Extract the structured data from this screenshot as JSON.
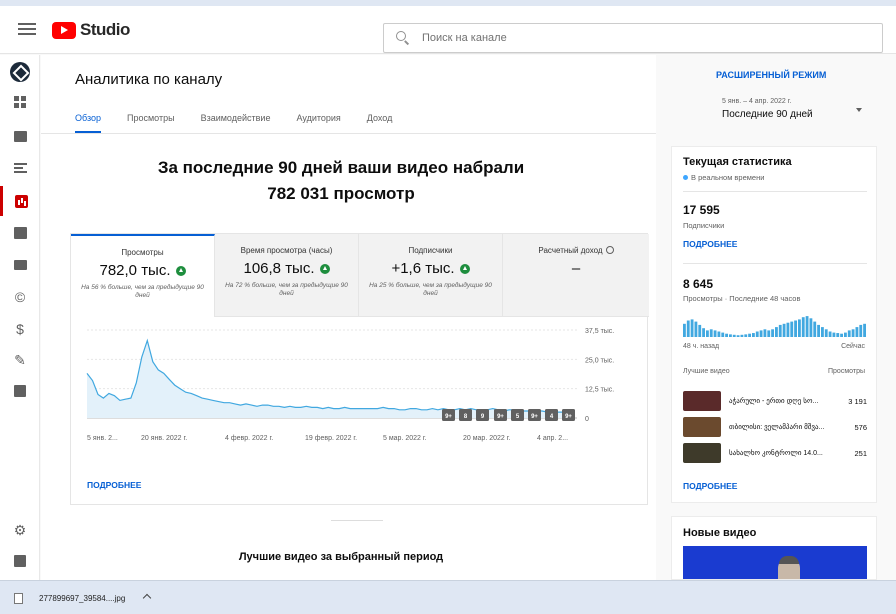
{
  "app": {
    "logo_text": "Studio",
    "search_placeholder": "Поиск на канале",
    "brand_color": "#ff0000",
    "accent_color": "#065fd4"
  },
  "sidebar": {
    "icons": [
      "channel-avatar-icon",
      "dashboard-icon",
      "content-icon",
      "playlists-icon",
      "analytics-icon",
      "comments-icon",
      "subtitles-icon",
      "copyright-icon",
      "monetization-icon",
      "customization-icon",
      "audio-library-icon",
      "settings-icon",
      "feedback-icon"
    ],
    "active": "analytics-icon"
  },
  "page": {
    "title": "Аналитика по каналу",
    "advanced_mode": "РАСШИРЕННЫЙ РЕЖИМ"
  },
  "tabs": [
    {
      "label": "Обзор",
      "active": true
    },
    {
      "label": "Просмотры",
      "active": false
    },
    {
      "label": "Взаимодействие",
      "active": false
    },
    {
      "label": "Аудитория",
      "active": false
    },
    {
      "label": "Доход",
      "active": false
    }
  ],
  "daterange": {
    "range": "5 янв. – 4 апр. 2022 г.",
    "label": "Последние 90 дней"
  },
  "headline": {
    "line1": "За последние 90 дней ваши видео набрали",
    "line2": "782 031 просмотр"
  },
  "metrics": [
    {
      "label": "Просмотры",
      "value": "782,0 тыс.",
      "note": "На 56 % больше, чем за предыдущие 90 дней",
      "trend": "up"
    },
    {
      "label": "Время просмотра (часы)",
      "value": "106,8 тыс.",
      "note": "На 72 % больше, чем за предыдущие 90 дней",
      "trend": "up"
    },
    {
      "label": "Подписчики",
      "value": "+1,6 тыс.",
      "note": "На 25 % больше, чем за предыдущие 90 дней",
      "trend": "up"
    },
    {
      "label": "Расчетный доход",
      "value": "–",
      "note": "",
      "trend": "none"
    }
  ],
  "chart_data": {
    "type": "area",
    "series": [
      {
        "values": [
          19000,
          16000,
          10000,
          8500,
          10500,
          9500,
          7500,
          8000,
          8500,
          15000,
          26000,
          33000,
          24000,
          20500,
          19000,
          16500,
          14000,
          12500,
          11000,
          10500,
          9500,
          8500,
          8000,
          7500,
          7000,
          6500,
          6500,
          6000,
          5500,
          6000,
          5500,
          5000,
          5500,
          5500,
          5000,
          5000,
          4500,
          5000,
          4500,
          4500,
          5000,
          4500,
          4500,
          4000,
          4500,
          4000,
          4000,
          4500,
          4000,
          4000,
          4000,
          4000,
          4000,
          4000,
          4500,
          4000,
          4000,
          3500,
          3500,
          4000,
          4000,
          3500,
          3500,
          4000,
          3500,
          4000,
          3500,
          3500,
          4000,
          3500,
          4000,
          3500,
          3500,
          3500,
          4000,
          3500,
          3000,
          3500,
          3500,
          3000,
          3000,
          3000,
          3000,
          3000,
          2500,
          2500,
          2500,
          2500,
          2500,
          2500
        ]
      }
    ],
    "y_ticks": [
      "0",
      "12,5 тыс.",
      "25,0 тыс.",
      "37,5 тыс."
    ],
    "ylim": [
      0,
      37500
    ],
    "x_ticks": [
      "5 янв. 2...",
      "20 янв. 2022 г.",
      "4 февр. 2022 г.",
      "19 февр. 2022 г.",
      "5 мар. 2022 г.",
      "20 мар. 2022 г.",
      "4 апр. 2..."
    ],
    "grid": true,
    "video_markers": [
      "9+",
      "8",
      "9",
      "9+",
      "5",
      "9+",
      "4",
      "9+"
    ]
  },
  "chart_more": "ПОДРОБНЕЕ",
  "best_title": "Лучшие видео за выбранный период",
  "realtime": {
    "title": "Текущая статистика",
    "subtitle": "В реальном времени",
    "subscribers": "17 595",
    "subscribers_label": "Подписчики",
    "more1": "ПОДРОБНЕЕ",
    "views": "8 645",
    "views_label": "Просмотры · Последние 48 часов",
    "bars": [
      60,
      75,
      80,
      70,
      55,
      40,
      30,
      35,
      30,
      25,
      20,
      15,
      12,
      10,
      8,
      10,
      12,
      15,
      18,
      25,
      30,
      35,
      30,
      35,
      45,
      55,
      60,
      65,
      70,
      75,
      80,
      90,
      95,
      85,
      70,
      55,
      45,
      35,
      25,
      20,
      18,
      15,
      20,
      30,
      35,
      45,
      55,
      60
    ],
    "axis_left": "48 ч. назад",
    "axis_right": "Сейчас",
    "top_header": "Лучшие видео",
    "top_header_right": "Просмотры",
    "top_videos": [
      {
        "title": "აჭარული - ერთი დღე სო...",
        "views": "3 191",
        "thumb_color": "#5a2a2a"
      },
      {
        "title": "თბილისი: ველამპარი მშვა...",
        "views": "576",
        "thumb_color": "#6b4a2e"
      },
      {
        "title": "სახალხო კონტროლი 14.0...",
        "views": "251",
        "thumb_color": "#3e3a2a"
      }
    ],
    "more2": "ПОДРОБНЕЕ"
  },
  "new_videos": {
    "title": "Новые видео"
  },
  "download": {
    "filename": "277899697_39584....jpg"
  }
}
